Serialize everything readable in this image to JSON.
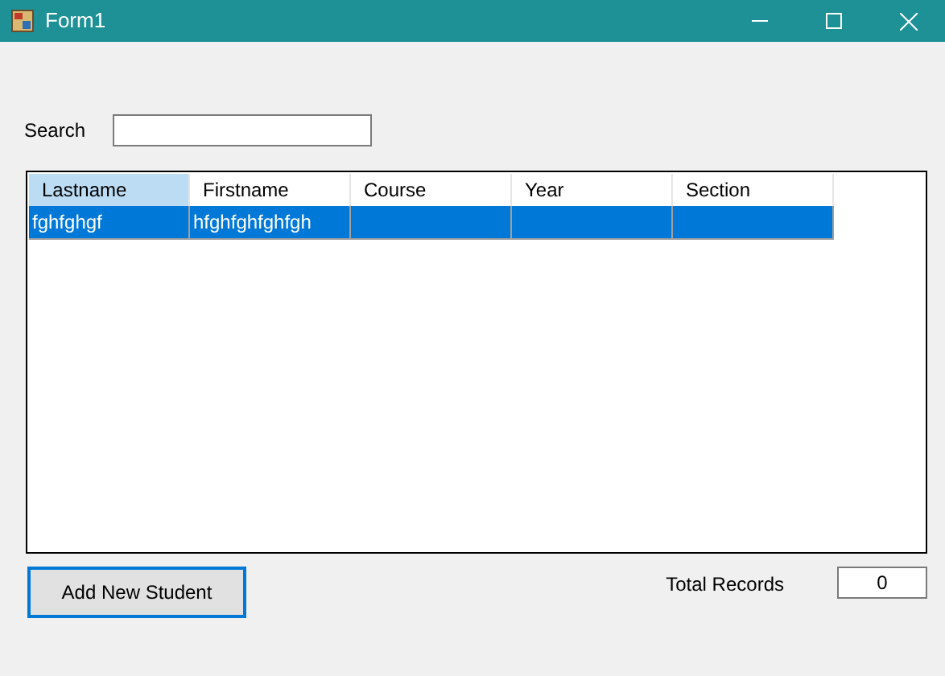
{
  "window": {
    "title": "Form1"
  },
  "search": {
    "label": "Search"
  },
  "table": {
    "columns": [
      {
        "label": "Lastname",
        "selected": true
      },
      {
        "label": "Firstname",
        "selected": false
      },
      {
        "label": "Course",
        "selected": false
      },
      {
        "label": "Year",
        "selected": false
      },
      {
        "label": "Section",
        "selected": false
      }
    ],
    "rows": [
      {
        "selected": true,
        "cells": [
          "fghfghgf",
          "hfghfghfghfgh",
          null,
          null,
          null
        ]
      }
    ]
  },
  "add_button": {
    "label": "Add New Student",
    "focused": true
  },
  "total": {
    "label": "Total Records",
    "value": "0"
  }
}
